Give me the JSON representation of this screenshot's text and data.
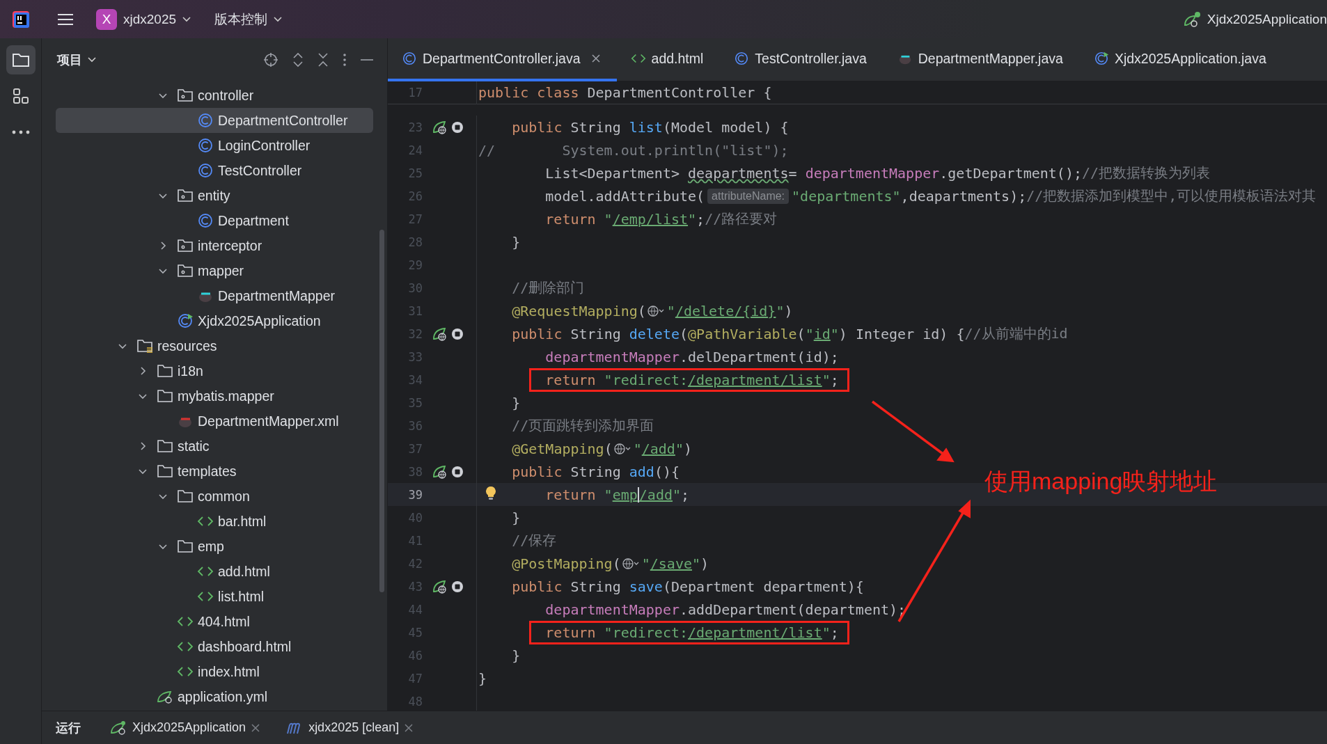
{
  "top_bar": {
    "project_switcher": {
      "badge": "X",
      "name": "xjdx2025"
    },
    "vcs_menu": "版本控制",
    "run_config": "Xjdx2025Application"
  },
  "tool_strip": [
    {
      "kind": "folder",
      "selected": true
    },
    {
      "kind": "structure",
      "selected": false
    },
    {
      "kind": "more",
      "selected": false
    }
  ],
  "project_panel": {
    "title": "项目",
    "tree": {
      "partial_branch": [
        {
          "label": "controller",
          "kind": "package",
          "expanded": true,
          "selected": false,
          "children": [
            {
              "label": "DepartmentController",
              "kind": "class",
              "selected": true
            },
            {
              "label": "LoginController",
              "kind": "class",
              "selected": false
            },
            {
              "label": "TestController",
              "kind": "class",
              "selected": false
            }
          ]
        },
        {
          "label": "entity",
          "kind": "package",
          "expanded": true,
          "selected": false,
          "children": [
            {
              "label": "Department",
              "kind": "class",
              "selected": false
            }
          ]
        },
        {
          "label": "interceptor",
          "kind": "package",
          "expanded": false,
          "selected": false
        },
        {
          "label": "mapper",
          "kind": "package",
          "expanded": true,
          "selected": false,
          "children": [
            {
              "label": "DepartmentMapper",
              "kind": "mybatis",
              "selected": false
            }
          ]
        },
        {
          "label": "Xjdx2025Application",
          "kind": "app",
          "selected": false
        }
      ],
      "items": [
        {
          "label": "resources",
          "kind": "resfolder",
          "expanded": true,
          "selected": false,
          "children": [
            {
              "label": "i18n",
              "kind": "folder",
              "expanded": false,
              "selected": false
            },
            {
              "label": "mybatis.mapper",
              "kind": "folder",
              "expanded": true,
              "selected": false,
              "children": [
                {
                  "label": "DepartmentMapper.xml",
                  "kind": "mybatisxml",
                  "selected": false
                }
              ]
            },
            {
              "label": "static",
              "kind": "folder",
              "expanded": false,
              "selected": false
            },
            {
              "label": "templates",
              "kind": "folder",
              "expanded": true,
              "selected": false,
              "children": [
                {
                  "label": "common",
                  "kind": "folder",
                  "expanded": true,
                  "selected": false,
                  "children": [
                    {
                      "label": "bar.html",
                      "kind": "html",
                      "selected": false
                    }
                  ]
                },
                {
                  "label": "emp",
                  "kind": "folder",
                  "expanded": true,
                  "selected": false,
                  "children": [
                    {
                      "label": "add.html",
                      "kind": "html",
                      "selected": false
                    },
                    {
                      "label": "list.html",
                      "kind": "html",
                      "selected": false
                    }
                  ]
                },
                {
                  "label": "404.html",
                  "kind": "html",
                  "selected": false
                },
                {
                  "label": "dashboard.html",
                  "kind": "html",
                  "selected": false
                },
                {
                  "label": "index.html",
                  "kind": "html",
                  "selected": false
                }
              ]
            },
            {
              "label": "application.yml",
              "kind": "yml",
              "selected": false
            }
          ]
        }
      ]
    }
  },
  "editor": {
    "tabs": [
      {
        "label": "DepartmentController.java",
        "kind": "class",
        "selected": true
      },
      {
        "label": "add.html",
        "kind": "html",
        "selected": false
      },
      {
        "label": "TestController.java",
        "kind": "class",
        "selected": false
      },
      {
        "label": "DepartmentMapper.java",
        "kind": "mybatis",
        "selected": false
      },
      {
        "label": "Xjdx2025Application.java",
        "kind": "app",
        "selected": false
      }
    ],
    "sticky_line": {
      "number": "17",
      "tokens": [
        {
          "kind": "kw",
          "text": "public"
        },
        {
          "kind": "kw",
          "text": " class"
        },
        {
          "kind": "p",
          "text": " DepartmentController {"
        }
      ]
    },
    "lines": [
      {
        "number": "23",
        "kind": "bean",
        "current": false,
        "boxed": false,
        "tokens": [
          {
            "kind": "kw",
            "text": "    public"
          },
          {
            "kind": "p",
            "text": " String "
          },
          {
            "kind": "fn",
            "text": "list"
          },
          {
            "kind": "p",
            "text": "(Model model) {"
          }
        ]
      },
      {
        "number": "24",
        "kind": "plain",
        "current": false,
        "boxed": false,
        "tokens": [
          {
            "kind": "cm",
            "text": "//        System.out.println(\"list\");"
          }
        ]
      },
      {
        "number": "25",
        "kind": "plain",
        "current": false,
        "boxed": false,
        "tokens": [
          {
            "kind": "p",
            "text": "        List<Department> "
          },
          {
            "kind": "warn",
            "text": "deapartments"
          },
          {
            "kind": "p",
            "text": "= "
          },
          {
            "kind": "fld",
            "text": "departmentMapper"
          },
          {
            "kind": "p",
            "text": ".getDepartment();"
          },
          {
            "kind": "cm",
            "text": "//把数据转换为列表"
          }
        ]
      },
      {
        "number": "26",
        "kind": "plain",
        "current": false,
        "boxed": false,
        "tokens": [
          {
            "kind": "p",
            "text": "        model.addAttribute("
          },
          {
            "kind": "hint",
            "text": "attributeName:"
          },
          {
            "kind": "str",
            "text": "\"departments\""
          },
          {
            "kind": "p",
            "text": ",deapartments);"
          },
          {
            "kind": "cm",
            "text": "//把数据添加到模型中,可以使用模板语法对其"
          }
        ]
      },
      {
        "number": "27",
        "kind": "plain",
        "current": false,
        "boxed": false,
        "tokens": [
          {
            "kind": "kw",
            "text": "        return"
          },
          {
            "kind": "str",
            "text": " \""
          },
          {
            "kind": "link",
            "text": "/emp/list"
          },
          {
            "kind": "str",
            "text": "\""
          },
          {
            "kind": "p",
            "text": ";"
          },
          {
            "kind": "cm",
            "text": "//路径要对"
          }
        ]
      },
      {
        "number": "28",
        "kind": "plain",
        "current": false,
        "boxed": false,
        "tokens": [
          {
            "kind": "p",
            "text": "    }"
          }
        ]
      },
      {
        "number": "29",
        "kind": "plain",
        "current": false,
        "boxed": false
      },
      {
        "number": "30",
        "kind": "plain",
        "current": false,
        "boxed": false,
        "tokens": [
          {
            "kind": "cm",
            "text": "    //删除部门"
          }
        ]
      },
      {
        "number": "31",
        "kind": "plain",
        "current": false,
        "boxed": false,
        "tokens": [
          {
            "kind": "ann",
            "text": "    @RequestMapping"
          },
          {
            "kind": "p",
            "text": "("
          },
          {
            "kind": "globe"
          },
          {
            "kind": "str",
            "text": "\""
          },
          {
            "kind": "link",
            "text": "/delete/{id}"
          },
          {
            "kind": "str",
            "text": "\""
          },
          {
            "kind": "p",
            "text": ")"
          }
        ]
      },
      {
        "number": "32",
        "kind": "bean",
        "current": false,
        "boxed": false,
        "tokens": [
          {
            "kind": "kw",
            "text": "    public"
          },
          {
            "kind": "p",
            "text": " String "
          },
          {
            "kind": "fn",
            "text": "delete"
          },
          {
            "kind": "p",
            "text": "("
          },
          {
            "kind": "ann",
            "text": "@PathVariable"
          },
          {
            "kind": "p",
            "text": "("
          },
          {
            "kind": "str",
            "text": "\""
          },
          {
            "kind": "link",
            "text": "id"
          },
          {
            "kind": "str",
            "text": "\""
          },
          {
            "kind": "p",
            "text": ") Integer id) {"
          },
          {
            "kind": "cm",
            "text": "//从前端中的id"
          }
        ]
      },
      {
        "number": "33",
        "kind": "plain",
        "current": false,
        "boxed": false,
        "tokens": [
          {
            "kind": "fld",
            "text": "        departmentMapper"
          },
          {
            "kind": "p",
            "text": ".delDepartment(id);"
          }
        ]
      },
      {
        "number": "34",
        "kind": "plain",
        "current": false,
        "boxed": true,
        "tokens": [
          {
            "kind": "kw",
            "text": "        return"
          },
          {
            "kind": "str",
            "text": " \"redirect:"
          },
          {
            "kind": "link",
            "text": "/department/list"
          },
          {
            "kind": "str",
            "text": "\""
          },
          {
            "kind": "p",
            "text": ";"
          }
        ]
      },
      {
        "number": "35",
        "kind": "plain",
        "current": false,
        "boxed": false,
        "tokens": [
          {
            "kind": "p",
            "text": "    }"
          }
        ]
      },
      {
        "number": "36",
        "kind": "plain",
        "current": false,
        "boxed": false,
        "tokens": [
          {
            "kind": "cm",
            "text": "    //页面跳转到添加界面"
          }
        ]
      },
      {
        "number": "37",
        "kind": "plain",
        "current": false,
        "boxed": false,
        "tokens": [
          {
            "kind": "ann",
            "text": "    @GetMapping"
          },
          {
            "kind": "p",
            "text": "("
          },
          {
            "kind": "globe"
          },
          {
            "kind": "str",
            "text": "\""
          },
          {
            "kind": "link",
            "text": "/add"
          },
          {
            "kind": "str",
            "text": "\""
          },
          {
            "kind": "p",
            "text": ")"
          }
        ]
      },
      {
        "number": "38",
        "kind": "bean",
        "current": false,
        "boxed": false,
        "tokens": [
          {
            "kind": "kw",
            "text": "    public"
          },
          {
            "kind": "p",
            "text": " String "
          },
          {
            "kind": "fn",
            "text": "add"
          },
          {
            "kind": "p",
            "text": "(){"
          }
        ]
      },
      {
        "number": "39",
        "kind": "bulb",
        "current": true,
        "boxed": false,
        "tokens": [
          {
            "kind": "kw",
            "text": "        return"
          },
          {
            "kind": "str",
            "text": " \""
          },
          {
            "kind": "link",
            "text": "emp"
          },
          {
            "kind": "caret"
          },
          {
            "kind": "link",
            "text": "/add"
          },
          {
            "kind": "str",
            "text": "\""
          },
          {
            "kind": "p",
            "text": ";"
          }
        ]
      },
      {
        "number": "40",
        "kind": "plain",
        "current": false,
        "boxed": false,
        "tokens": [
          {
            "kind": "p",
            "text": "    }"
          }
        ]
      },
      {
        "number": "41",
        "kind": "plain",
        "current": false,
        "boxed": false,
        "tokens": [
          {
            "kind": "cm",
            "text": "    //保存"
          }
        ]
      },
      {
        "number": "42",
        "kind": "plain",
        "current": false,
        "boxed": false,
        "tokens": [
          {
            "kind": "ann",
            "text": "    @PostMapping"
          },
          {
            "kind": "p",
            "text": "("
          },
          {
            "kind": "globe"
          },
          {
            "kind": "str",
            "text": "\""
          },
          {
            "kind": "link",
            "text": "/save"
          },
          {
            "kind": "str",
            "text": "\""
          },
          {
            "kind": "p",
            "text": ")"
          }
        ]
      },
      {
        "number": "43",
        "kind": "bean",
        "current": false,
        "boxed": false,
        "tokens": [
          {
            "kind": "kw",
            "text": "    public"
          },
          {
            "kind": "p",
            "text": " String "
          },
          {
            "kind": "fn",
            "text": "save"
          },
          {
            "kind": "p",
            "text": "(Department department){"
          }
        ]
      },
      {
        "number": "44",
        "kind": "plain",
        "current": false,
        "boxed": false,
        "tokens": [
          {
            "kind": "fld",
            "text": "        departmentMapper"
          },
          {
            "kind": "p",
            "text": ".addDepartment(department);"
          }
        ]
      },
      {
        "number": "45",
        "kind": "plain",
        "current": false,
        "boxed": true,
        "tokens": [
          {
            "kind": "kw",
            "text": "        return"
          },
          {
            "kind": "str",
            "text": " \"redirect:"
          },
          {
            "kind": "link",
            "text": "/department/list"
          },
          {
            "kind": "str",
            "text": "\""
          },
          {
            "kind": "p",
            "text": ";"
          }
        ]
      },
      {
        "number": "46",
        "kind": "plain",
        "current": false,
        "boxed": false,
        "tokens": [
          {
            "kind": "p",
            "text": "    }"
          }
        ]
      },
      {
        "number": "47",
        "kind": "plain",
        "current": false,
        "boxed": false,
        "tokens": [
          {
            "kind": "p",
            "text": "}"
          }
        ]
      },
      {
        "number": "48",
        "kind": "plain",
        "current": false,
        "boxed": false
      }
    ],
    "annotation": {
      "text": "使用mapping映射地址"
    }
  },
  "run_panel": {
    "title": "运行",
    "tabs": [
      {
        "label": "Xjdx2025Application",
        "kind": "spring",
        "selected": false
      },
      {
        "label": "xjdx2025 [clean]",
        "kind": "maven",
        "selected": false
      }
    ]
  }
}
